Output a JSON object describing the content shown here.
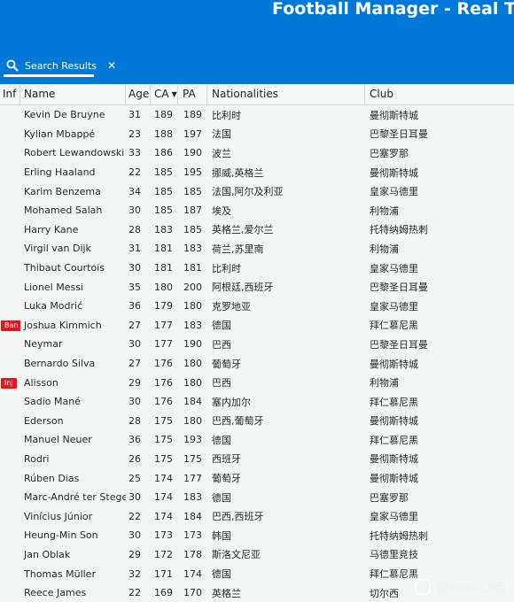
{
  "app": {
    "title": "Football Manager - Real Time E",
    "accent_color": "#0078d7"
  },
  "tab": {
    "icon": "search-icon",
    "label": "Search Results",
    "close_glyph": "✕"
  },
  "table": {
    "columns": {
      "inf": "Inf",
      "name": "Name",
      "age": "Age",
      "ca": "CA",
      "ca_sort_glyph": "▼",
      "pa": "PA",
      "nationalities": "Nationalities",
      "club": "Club"
    },
    "rows": [
      {
        "inf": "",
        "name": "Kevin De Bruyne",
        "age": "31",
        "ca": "189",
        "pa": "189",
        "nat": "比利时",
        "club": "曼彻斯特城"
      },
      {
        "inf": "",
        "name": "Kylian Mbappé",
        "age": "23",
        "ca": "188",
        "pa": "197",
        "nat": "法国",
        "club": "巴黎圣日耳曼"
      },
      {
        "inf": "",
        "name": "Robert Lewandowski",
        "age": "33",
        "ca": "186",
        "pa": "190",
        "nat": "波兰",
        "club": "巴塞罗那"
      },
      {
        "inf": "",
        "name": "Erling Haaland",
        "age": "22",
        "ca": "185",
        "pa": "195",
        "nat": "挪威,英格兰",
        "club": "曼彻斯特城"
      },
      {
        "inf": "",
        "name": "Karim Benzema",
        "age": "34",
        "ca": "185",
        "pa": "185",
        "nat": "法国,阿尔及利亚",
        "club": "皇家马德里"
      },
      {
        "inf": "",
        "name": "Mohamed Salah",
        "age": "30",
        "ca": "185",
        "pa": "187",
        "nat": "埃及",
        "club": "利物浦"
      },
      {
        "inf": "",
        "name": "Harry Kane",
        "age": "28",
        "ca": "183",
        "pa": "185",
        "nat": "英格兰,爱尔兰",
        "club": "托特纳姆热刺"
      },
      {
        "inf": "",
        "name": "Virgil van Dijk",
        "age": "31",
        "ca": "181",
        "pa": "183",
        "nat": "荷兰,苏里南",
        "club": "利物浦"
      },
      {
        "inf": "",
        "name": "Thibaut Courtois",
        "age": "30",
        "ca": "181",
        "pa": "181",
        "nat": "比利时",
        "club": "皇家马德里"
      },
      {
        "inf": "",
        "name": "Lionel Messi",
        "age": "35",
        "ca": "180",
        "pa": "200",
        "nat": "阿根廷,西班牙",
        "club": "巴黎圣日耳曼"
      },
      {
        "inf": "",
        "name": "Luka Modrić",
        "age": "36",
        "ca": "179",
        "pa": "180",
        "nat": "克罗地亚",
        "club": "皇家马德里"
      },
      {
        "inf": "Ban",
        "name": "Joshua Kimmich",
        "age": "27",
        "ca": "177",
        "pa": "183",
        "nat": "德国",
        "club": "拜仁慕尼黑"
      },
      {
        "inf": "",
        "name": "Neymar",
        "age": "30",
        "ca": "177",
        "pa": "190",
        "nat": "巴西",
        "club": "巴黎圣日耳曼"
      },
      {
        "inf": "",
        "name": "Bernardo Silva",
        "age": "27",
        "ca": "176",
        "pa": "180",
        "nat": "葡萄牙",
        "club": "曼彻斯特城"
      },
      {
        "inf": "Inj",
        "name": "Alisson",
        "age": "29",
        "ca": "176",
        "pa": "180",
        "nat": "巴西",
        "club": "利物浦"
      },
      {
        "inf": "",
        "name": "Sadio Mané",
        "age": "30",
        "ca": "176",
        "pa": "184",
        "nat": "塞内加尔",
        "club": "拜仁慕尼黑"
      },
      {
        "inf": "",
        "name": "Ederson",
        "age": "28",
        "ca": "175",
        "pa": "180",
        "nat": "巴西,葡萄牙",
        "club": "曼彻斯特城"
      },
      {
        "inf": "",
        "name": "Manuel Neuer",
        "age": "36",
        "ca": "175",
        "pa": "193",
        "nat": "德国",
        "club": "拜仁慕尼黑"
      },
      {
        "inf": "",
        "name": "Rodri",
        "age": "26",
        "ca": "175",
        "pa": "175",
        "nat": "西班牙",
        "club": "曼彻斯特城"
      },
      {
        "inf": "",
        "name": "Rúben Dias",
        "age": "25",
        "ca": "174",
        "pa": "177",
        "nat": "葡萄牙",
        "club": "曼彻斯特城"
      },
      {
        "inf": "",
        "name": "Marc-André ter Stegen",
        "age": "30",
        "ca": "174",
        "pa": "183",
        "nat": "德国",
        "club": "巴塞罗那"
      },
      {
        "inf": "",
        "name": "Vinícius Júnior",
        "age": "22",
        "ca": "174",
        "pa": "184",
        "nat": "巴西,西班牙",
        "club": "皇家马德里"
      },
      {
        "inf": "",
        "name": "Heung-Min Son",
        "age": "30",
        "ca": "173",
        "pa": "173",
        "nat": "韩国",
        "club": "托特纳姆热刺"
      },
      {
        "inf": "",
        "name": "Jan Oblak",
        "age": "29",
        "ca": "172",
        "pa": "178",
        "nat": "斯洛文尼亚",
        "club": "马德里竞技"
      },
      {
        "inf": "",
        "name": "Thomas Müller",
        "age": "32",
        "ca": "171",
        "pa": "174",
        "nat": "德国",
        "club": "拜仁慕尼黑"
      },
      {
        "inf": "",
        "name": "Reece James",
        "age": "22",
        "ca": "169",
        "pa": "170",
        "nat": "英格兰",
        "club": "切尔西"
      }
    ],
    "badge_color": "#e8141b"
  },
  "watermark": {
    "text": "@fm2023吧"
  }
}
